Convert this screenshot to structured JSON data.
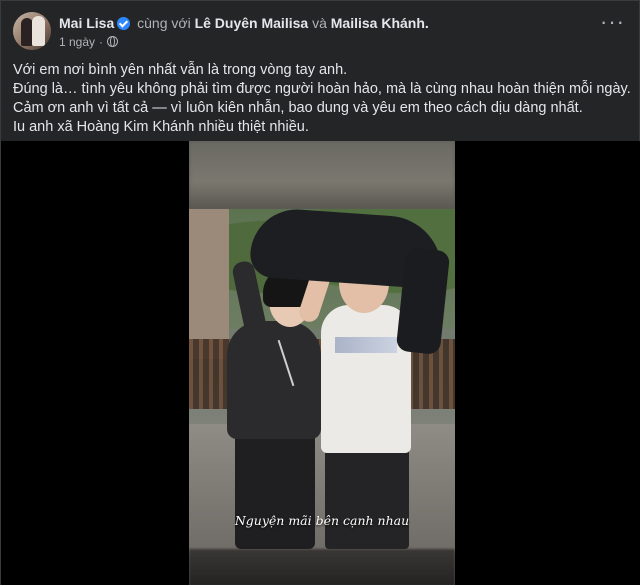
{
  "post": {
    "author": "Mai Lisa",
    "with_text": "cùng với",
    "tagged_1": "Lê Duyên Mailisa",
    "and_text": "và",
    "tagged_2": "Mailisa Khánh.",
    "timestamp": "1 ngày",
    "dot": "·",
    "audience_icon": "globe-icon",
    "more_icon": "more-options-icon",
    "caption_lines": [
      "Với em nơi bình yên nhất vẫn là trong vòng tay anh.",
      "Đúng là… tình yêu không phải tìm được người hoàn hảo, mà là cùng nhau hoàn thiện mỗi ngày.",
      "Cảm ơn anh vì tất cả — vì luôn kiên nhẫn, bao dung và yêu em theo cách dịu dàng nhất.",
      "Iu anh xã Hoàng Kim Khánh nhiều thiệt nhiều."
    ],
    "image_overlay_text": "Nguyện mãi bên cạnh nhau"
  },
  "colors": {
    "background": "#242526",
    "text": "#e4e6eb",
    "muted": "#b0b3b8",
    "verified": "#2d88ff"
  }
}
